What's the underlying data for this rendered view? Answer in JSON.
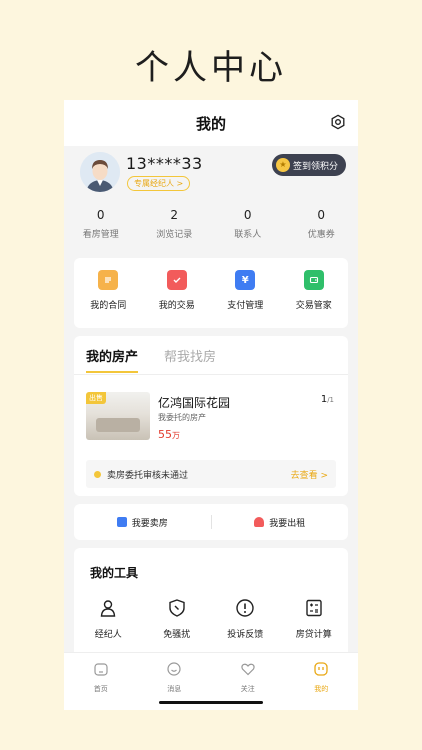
{
  "hero_title": "个人中心",
  "nav": {
    "title": "我的"
  },
  "profile": {
    "phone": "13****33",
    "agent_tag": "专属经纪人 >",
    "checkin": "签到领积分",
    "coin_glyph": "★"
  },
  "stats": [
    {
      "value": "0",
      "label": "看房管理"
    },
    {
      "value": "2",
      "label": "浏览记录"
    },
    {
      "value": "0",
      "label": "联系人"
    },
    {
      "value": "0",
      "label": "优惠券"
    }
  ],
  "quick": [
    {
      "label": "我的合同",
      "icon": "contract-icon",
      "color": "#f6b24a"
    },
    {
      "label": "我的交易",
      "icon": "trade-icon",
      "color": "#f25b5b"
    },
    {
      "label": "支付管理",
      "icon": "payment-icon",
      "color": "#3f7cf2",
      "glyph": "¥"
    },
    {
      "label": "交易管家",
      "icon": "wallet-icon",
      "color": "#2fbf6a"
    }
  ],
  "property": {
    "tabs": [
      "我的房产",
      "帮我找房"
    ],
    "badge": "出售",
    "name": "亿鸿国际花园",
    "sub": "我委托的房产",
    "price": "55",
    "unit": "万",
    "page_current": "1",
    "page_total": "/1",
    "notice": "卖房委托审核未通过",
    "notice_link": "去查看 >"
  },
  "actions": [
    {
      "label": "我要卖房",
      "color": "#3f7cf2"
    },
    {
      "label": "我要出租",
      "color": "#f25b5b"
    }
  ],
  "tools": {
    "title": "我的工具",
    "items": [
      {
        "label": "经纪人",
        "icon": "agent-icon"
      },
      {
        "label": "免骚扰",
        "icon": "shield-icon"
      },
      {
        "label": "投诉反馈",
        "icon": "alert-icon"
      },
      {
        "label": "房贷计算",
        "icon": "calculator-icon"
      }
    ]
  },
  "tabbar": [
    {
      "label": "首页",
      "icon": "home-icon"
    },
    {
      "label": "消息",
      "icon": "message-icon"
    },
    {
      "label": "关注",
      "icon": "heart-icon"
    },
    {
      "label": "我的",
      "icon": "profile-icon",
      "active": true
    }
  ],
  "colors": {
    "accent": "#f3c63a",
    "background": "#fdf6de",
    "price": "#e23a2c"
  }
}
